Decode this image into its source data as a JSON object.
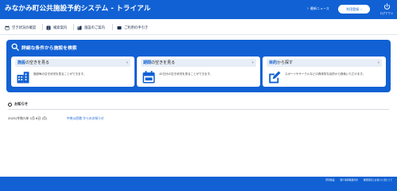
{
  "header": {
    "title": "みなかみ町公共施設予約システム - トライアル",
    "news_label": "最新ニュース",
    "register_label": "利用登録",
    "logout_label": "ログアウト"
  },
  "nav": {
    "items": [
      {
        "label": "空き状況の確認",
        "icon": "calendar-icon"
      },
      {
        "label": "検索案内",
        "icon": "info-icon"
      },
      {
        "label": "施設のご案内",
        "icon": "building-icon"
      },
      {
        "label": "ご利用の手引き",
        "icon": "book-icon"
      }
    ]
  },
  "search": {
    "title": "詳細な条件から施設を検索",
    "cards": [
      {
        "strong": "施設",
        "rest": "の空きを見る",
        "desc": "施設毎の空き状況を見ることができます。",
        "icon": "building-icon"
      },
      {
        "strong": "期間",
        "rest": "の空きを見る",
        "desc": "40日分の空き状況を見ることができます。",
        "icon": "calendar-icon"
      },
      {
        "strong": "目的",
        "rest": "から探す",
        "desc": "スポーツやサークルなどの具体的な目的から検索いただけます。",
        "icon": "pencil-icon"
      }
    ]
  },
  "notice": {
    "title": "お知らせ",
    "date": "2025(令和7)年 1月 6日 (月)",
    "link": "中央公民館 からのお知らせ"
  },
  "footer": {
    "links": [
      "所管施設",
      "個人情報保護方針",
      "推奨環境とお使いに当たって"
    ]
  },
  "colors": {
    "brand": "#1161d4",
    "card_head_bg": "#e7eef7"
  }
}
